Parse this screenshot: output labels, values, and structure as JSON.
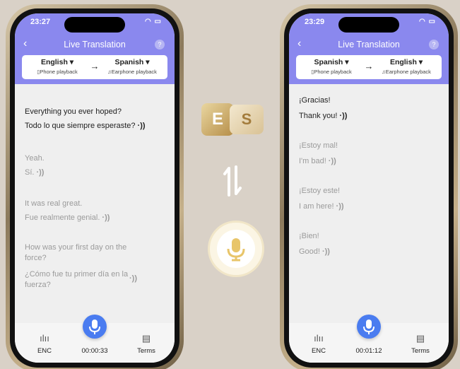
{
  "left_phone": {
    "status_time": "23:27",
    "title": "Live Translation",
    "source_lang": "English ▾",
    "source_sub": "Phone playback",
    "target_lang": "Spanish ▾",
    "target_sub": "Earphone playback",
    "messages": [
      {
        "text": "Everything you ever hoped?"
      },
      {
        "text": "Todo lo que siempre esperaste?"
      },
      {
        "text": "Yeah."
      },
      {
        "text": "Sí."
      },
      {
        "text": "It was real great."
      },
      {
        "text": "Fue realmente genial."
      },
      {
        "text": "How was your first day on the force?"
      },
      {
        "text": "¿Cómo fue tu primer día en la fuerza?"
      }
    ],
    "enc_label": "ENC",
    "timer": "00:00:33",
    "terms_label": "Terms"
  },
  "right_phone": {
    "status_time": "23:29",
    "title": "Live Translation",
    "source_lang": "Spanish ▾",
    "source_sub": "Phone playback",
    "target_lang": "English ▾",
    "target_sub": "Earphone playback",
    "messages": [
      {
        "text": "¡Gracias!"
      },
      {
        "text": "Thank you!"
      },
      {
        "text": "¡Estoy mal!"
      },
      {
        "text": "I'm bad!"
      },
      {
        "text": "¡Estoy este!"
      },
      {
        "text": "I am here!"
      },
      {
        "text": "¡Bien!"
      },
      {
        "text": "Good!"
      }
    ],
    "enc_label": "ENC",
    "timer": "00:01:12",
    "terms_label": "Terms"
  },
  "badge": {
    "e": "E",
    "s": "S"
  },
  "colors": {
    "header": "#8a88ee",
    "mic": "#4a7cf0",
    "gold": "#b68e48"
  }
}
